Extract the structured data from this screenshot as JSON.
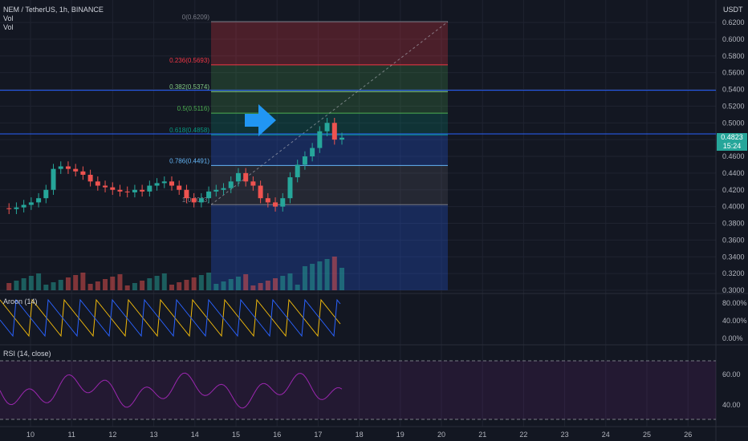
{
  "header": {
    "symbol_line": "NEM / TetherUS, 1h, BINANCE",
    "vol1": "Vol",
    "vol2": "Vol",
    "currency": "USDT"
  },
  "last_price": {
    "value": "0.4823",
    "countdown": "15:24",
    "color": "#26a69a"
  },
  "panes": {
    "aroon_label": "Aroon (14)",
    "rsi_label": "RSI (14, close)"
  },
  "colors": {
    "up": "#26a69a",
    "down": "#ef5350",
    "aroon_up": "#f0b90b",
    "aroon_down": "#2962ff",
    "rsi": "#9c27b0"
  },
  "chart_data": {
    "type": "candlestick",
    "price_axis": {
      "ticks": [
        "0.6200",
        "0.6000",
        "0.5800",
        "0.5600",
        "0.5400",
        "0.5200",
        "0.5000",
        "0.4800",
        "0.4600",
        "0.4400",
        "0.4200",
        "0.4000",
        "0.3800",
        "0.3600",
        "0.3400",
        "0.3200",
        "0.3000"
      ],
      "ylim": [
        0.3,
        0.62
      ]
    },
    "time_axis": {
      "ticks": [
        "10",
        "11",
        "12",
        "13",
        "14",
        "15",
        "16",
        "17",
        "18",
        "19",
        "20",
        "21",
        "22",
        "23",
        "24",
        "25",
        "26"
      ]
    },
    "fib_levels": [
      {
        "label": "0(0.6209)",
        "ratio": 0,
        "price": 0.6209,
        "color": "#787b86"
      },
      {
        "label": "0.236(0.5693)",
        "ratio": 0.236,
        "price": 0.5693,
        "color": "#f23645"
      },
      {
        "label": "0.382(0.5374)",
        "ratio": 0.382,
        "price": 0.5374,
        "color": "#81c784"
      },
      {
        "label": "0.5(0.5116)",
        "ratio": 0.5,
        "price": 0.5116,
        "color": "#4caf50"
      },
      {
        "label": "0.618(0.4858)",
        "ratio": 0.618,
        "price": 0.4858,
        "color": "#089981"
      },
      {
        "label": "0.786(0.4491)",
        "ratio": 0.786,
        "price": 0.4491,
        "color": "#64b5f6"
      },
      {
        "label": "1(0.4023)",
        "ratio": 1,
        "price": 0.4023,
        "color": "#787b86"
      }
    ],
    "horizontal_lines": [
      0.5389,
      0.4868
    ],
    "price_series": [
      0.398,
      0.397,
      0.399,
      0.402,
      0.405,
      0.41,
      0.42,
      0.445,
      0.448,
      0.445,
      0.442,
      0.438,
      0.43,
      0.425,
      0.423,
      0.42,
      0.418,
      0.417,
      0.42,
      0.418,
      0.425,
      0.428,
      0.43,
      0.425,
      0.42,
      0.41,
      0.405,
      0.41,
      0.418,
      0.42,
      0.422,
      0.43,
      0.44,
      0.43,
      0.425,
      0.41,
      0.405,
      0.4,
      0.41,
      0.435,
      0.45,
      0.46,
      0.47,
      0.49,
      0.5,
      0.48,
      0.4823
    ],
    "aroon": {
      "ticks": [
        "80.00%",
        "40.00%",
        "0.00%"
      ]
    },
    "rsi": {
      "ticks": [
        "60.00",
        "40.00"
      ]
    }
  }
}
